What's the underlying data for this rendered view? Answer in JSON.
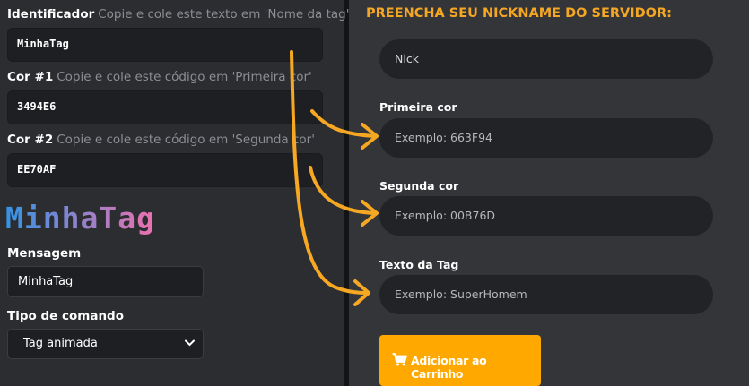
{
  "left": {
    "identifier": {
      "label": "Identificador",
      "hint": "Copie e cole este texto em 'Nome da tag'",
      "value": "MinhaTag"
    },
    "color1": {
      "label": "Cor #1",
      "hint": "Copie e cole este código em 'Primeira cor'",
      "value": "3494E6"
    },
    "color2": {
      "label": "Cor #2",
      "hint": "Copie e cole este código em 'Segunda cor'",
      "value": "EE70AF"
    },
    "preview_text": "MinhaTag",
    "message": {
      "label": "Mensagem",
      "value": "MinhaTag"
    },
    "command_type": {
      "label": "Tipo de comando",
      "selected": "Tag animada"
    }
  },
  "right": {
    "title": "PREENCHA SEU NICKNAME DO SERVIDOR:",
    "nick": {
      "value": "Nick"
    },
    "first_color": {
      "label": "Primeira cor",
      "placeholder": "Exemplo: 663F94"
    },
    "second_color": {
      "label": "Segunda cor",
      "placeholder": "Exemplo: 00B76D"
    },
    "tag_text": {
      "label": "Texto da Tag",
      "placeholder": "Exemplo: SuperHomem"
    },
    "add_to_cart": "Adicionar ao Carrinho"
  },
  "colors": {
    "gradient_start": "#3494E6",
    "gradient_end": "#EE70AF",
    "accent": "#ffa900",
    "arrow": "#f7a823"
  },
  "icons": {
    "cart": "shopping-cart-icon",
    "select": "chevron-down-icon"
  }
}
